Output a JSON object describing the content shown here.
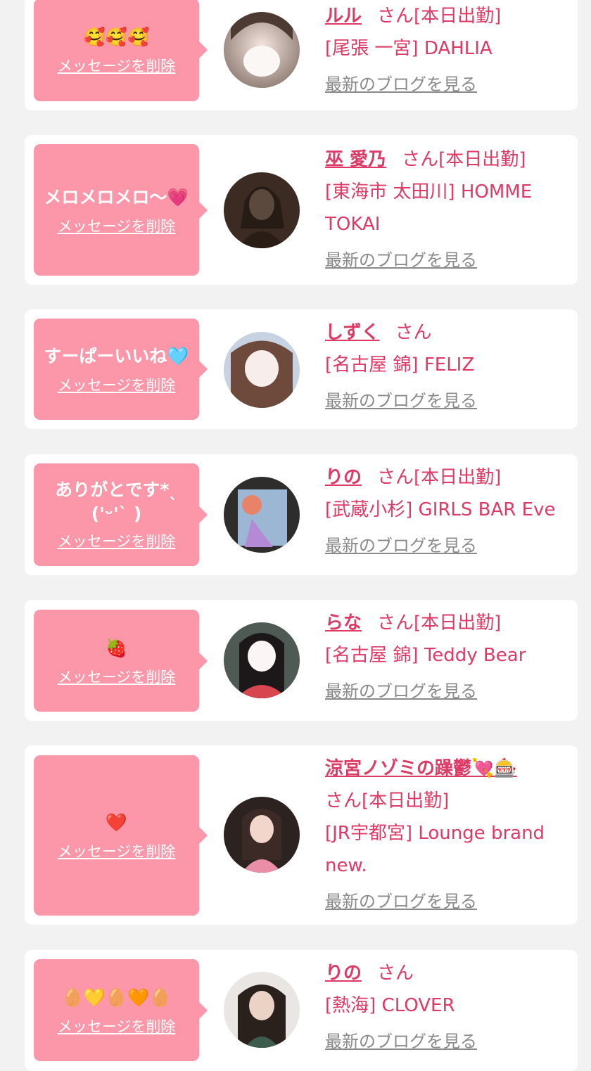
{
  "delete_label": "メッセージを削除",
  "blog_label": "最新のブログを見る",
  "colors": {
    "background": "#f2f2f2",
    "card": "#ffffff",
    "bubble": "#fb97a9",
    "accent": "#dd3b66",
    "link_gray": "#8a8a8a"
  },
  "items": [
    {
      "message": "🥰🥰🥰",
      "name": "ルル",
      "suffix": "さん[本日出勤]",
      "shop": "[尾張 一宮] DAHLIA",
      "avatar_icon": "profile-photo-icon"
    },
    {
      "message": "メロメロメロ〜💗",
      "name": "巫 愛乃",
      "suffix": "さん[本日出勤]",
      "shop": "[東海市 太田川] HOMME TOKAI",
      "avatar_icon": "profile-photo-icon"
    },
    {
      "message": "すーぱーいいね🩵",
      "name": "しずく",
      "suffix": "さん",
      "shop": "[名古屋 錦] FELIZ",
      "avatar_icon": "profile-photo-icon"
    },
    {
      "message": "ありがとです*ˎ('ᵕ'ˋ )",
      "name": "りの",
      "suffix": "さん[本日出勤]",
      "shop": "[武蔵小杉] GIRLS BAR Eve",
      "avatar_icon": "profile-photo-icon"
    },
    {
      "message": "🍓",
      "name": "らな",
      "suffix": "さん[本日出勤]",
      "shop": "[名古屋 錦] Teddy Bear",
      "avatar_icon": "profile-photo-icon"
    },
    {
      "message": "❤️",
      "name": "涼宮ノゾミの躁鬱💘🎰",
      "suffix": "さん[本日出勤]",
      "shop": "[JR宇都宮] Lounge brand new.",
      "avatar_icon": "profile-photo-icon"
    },
    {
      "message": "🥚💛🥚🧡🥚",
      "name": "りの",
      "suffix": "さん",
      "shop": "[熱海] CLOVER",
      "avatar_icon": "profile-photo-icon"
    }
  ]
}
